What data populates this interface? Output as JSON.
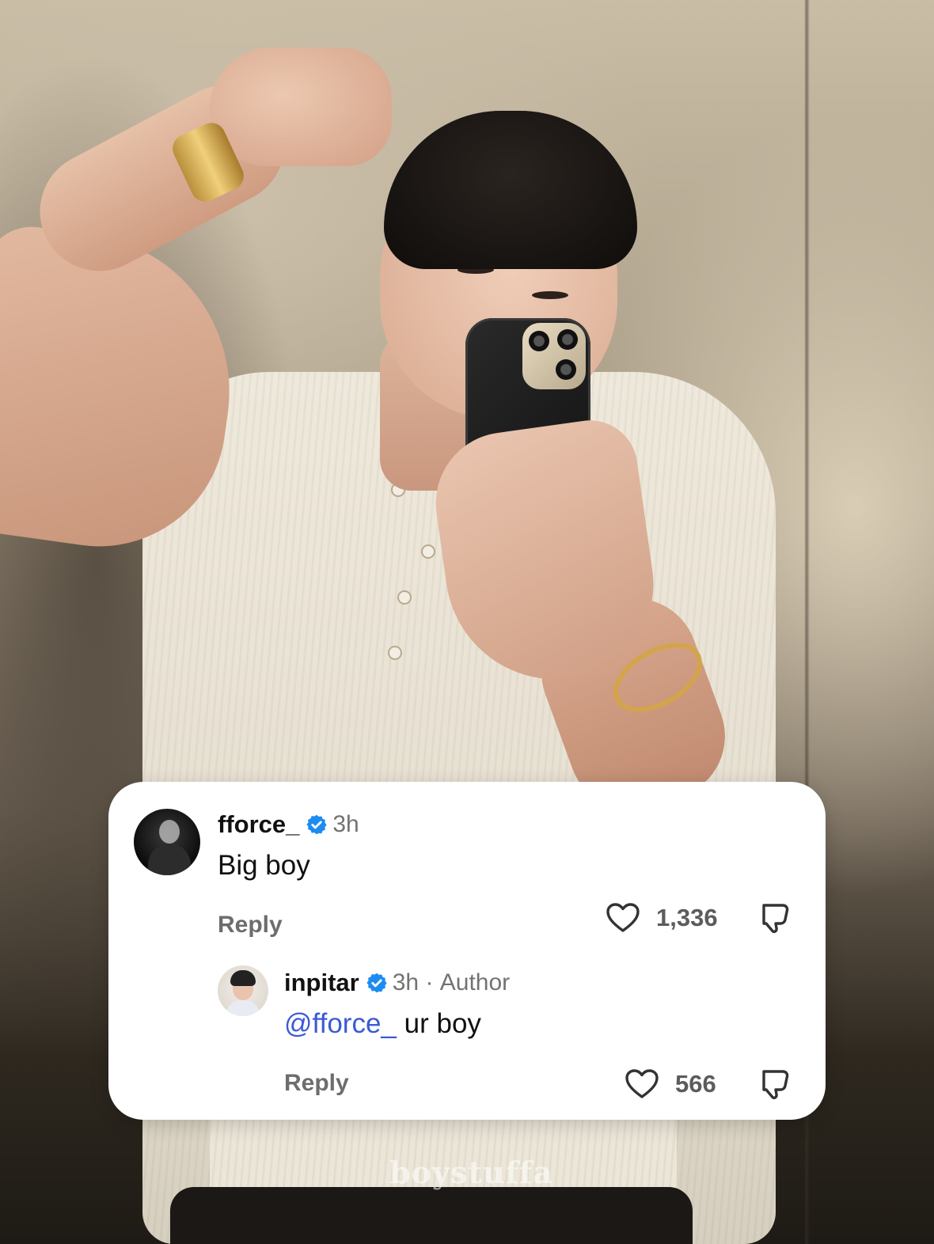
{
  "watermark": "boystuffa",
  "comments": [
    {
      "username": "fforce_",
      "verified": true,
      "time": "3h",
      "text": "Big boy",
      "reply_label": "Reply",
      "likes": "1,336"
    },
    {
      "username": "inpitar",
      "verified": true,
      "time": "3h",
      "separator": " · ",
      "author_tag": "Author",
      "mention": "@fforce_",
      "text": " ur boy",
      "reply_label": "Reply",
      "likes": "566"
    }
  ],
  "icons": {
    "verified": "verified-badge-icon",
    "like": "heart-icon",
    "dislike": "dislike-icon"
  },
  "colors": {
    "verified_blue": "#1d8cf0",
    "mention_blue": "#3a5ad8",
    "card_bg": "#ffffff"
  }
}
